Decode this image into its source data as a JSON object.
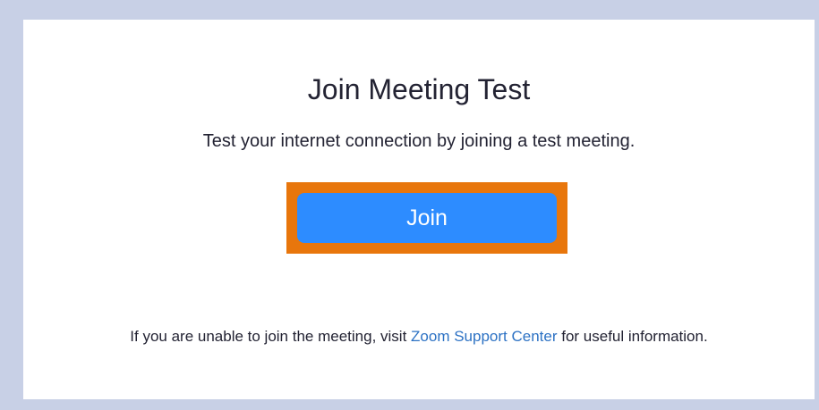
{
  "page": {
    "title": "Join Meeting Test",
    "subtitle": "Test your internet connection by joining a test meeting."
  },
  "join_button": {
    "label": "Join"
  },
  "footer": {
    "text_before": "If you are unable to join the meeting, visit ",
    "link_text": "Zoom Support Center",
    "text_after": " for useful information."
  },
  "colors": {
    "page_background": "#c8d0e6",
    "card_background": "#ffffff",
    "button_blue": "#2d8cff",
    "highlight_orange": "#e8760c",
    "link_blue": "#2d72c4",
    "text_dark": "#232333"
  }
}
